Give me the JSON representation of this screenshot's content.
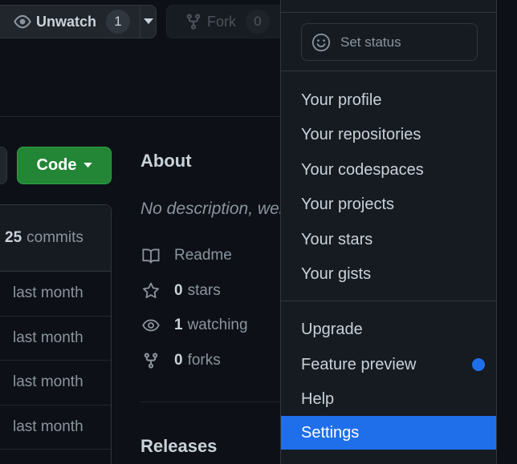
{
  "header": {
    "unwatch": {
      "label": "Unwatch",
      "count": "1"
    },
    "fork": {
      "label": "Fork",
      "count": "0"
    }
  },
  "files": {
    "code_button": "Code",
    "commit_count": "25",
    "commits_label": "commits",
    "rows": [
      "last month",
      "last month",
      "last month",
      "last month"
    ]
  },
  "about": {
    "title": "About",
    "description": "No description, website, or topics provided.",
    "readme": "Readme",
    "stars_count": "0",
    "stars_label": "stars",
    "watching_count": "1",
    "watching_label": "watching",
    "forks_count": "0",
    "forks_label": "forks",
    "releases_title": "Releases"
  },
  "menu": {
    "set_status": "Set status",
    "items": [
      "Your profile",
      "Your repositories",
      "Your codespaces",
      "Your projects",
      "Your stars",
      "Your gists",
      "Upgrade",
      "Feature preview",
      "Help",
      "Settings"
    ],
    "active_item": "Settings",
    "colors": {
      "accent": "#1f6feb",
      "code_button": "#238636"
    }
  }
}
